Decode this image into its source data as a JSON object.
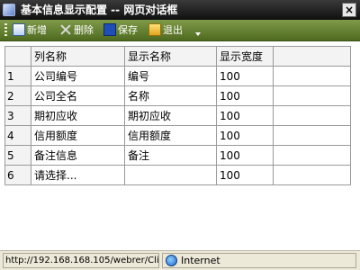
{
  "window": {
    "title": "基本信息显示配置 -- 网页对话框",
    "close_label": "×"
  },
  "toolbar": {
    "add_label": "新增",
    "delete_label": "删除",
    "save_label": "保存",
    "exit_label": "退出"
  },
  "grid": {
    "columns": [
      "列名称",
      "显示名称",
      "显示宽度",
      ""
    ],
    "rows": [
      {
        "num": "1",
        "col_name": "公司编号",
        "display_name": "编号",
        "width": "100",
        "extra": ""
      },
      {
        "num": "2",
        "col_name": "公司全名",
        "display_name": "名称",
        "width": "100",
        "extra": ""
      },
      {
        "num": "3",
        "col_name": "期初应收",
        "display_name": "期初应收",
        "width": "100",
        "extra": ""
      },
      {
        "num": "4",
        "col_name": "信用额度",
        "display_name": "信用额度",
        "width": "100",
        "extra": ""
      },
      {
        "num": "5",
        "col_name": "备注信息",
        "display_name": "备注",
        "width": "100",
        "extra": ""
      },
      {
        "num": "6",
        "col_name": "请选择...",
        "display_name": "",
        "width": "100",
        "extra": ""
      }
    ]
  },
  "status": {
    "url": "http://192.168.168.105/webrer/Cli",
    "zone": "Internet"
  }
}
